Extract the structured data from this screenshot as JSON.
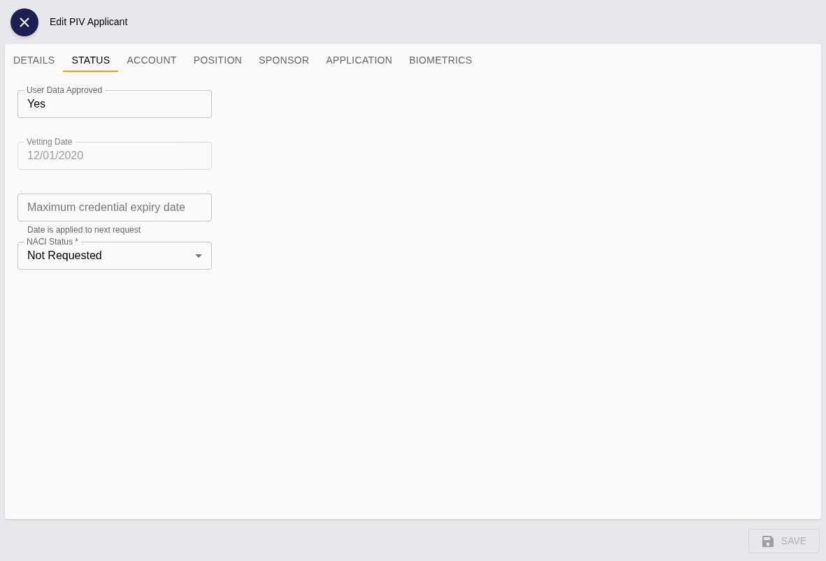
{
  "header": {
    "title": "Edit PIV Applicant"
  },
  "tabs": [
    {
      "label": "DETAILS",
      "selected": false
    },
    {
      "label": "STATUS",
      "selected": true
    },
    {
      "label": "ACCOUNT",
      "selected": false
    },
    {
      "label": "POSITION",
      "selected": false
    },
    {
      "label": "SPONSOR",
      "selected": false
    },
    {
      "label": "APPLICATION",
      "selected": false
    },
    {
      "label": "BIOMETRICS",
      "selected": false
    }
  ],
  "fields": [
    {
      "kind": "text",
      "label": "User Data Approved",
      "value": "Yes",
      "disabled": false
    },
    {
      "kind": "text",
      "label": "Vetting Date",
      "value": "12/01/2020",
      "disabled": true
    },
    {
      "kind": "input",
      "placeholder": "Maximum credential expiry date",
      "helper": "Date is applied to next request",
      "disabled": false
    },
    {
      "kind": "select",
      "label": "NACI Status *",
      "value": "Not Requested",
      "disabled": false
    }
  ],
  "footer": {
    "save_button": {
      "label": "SAVE",
      "disabled": true
    }
  }
}
